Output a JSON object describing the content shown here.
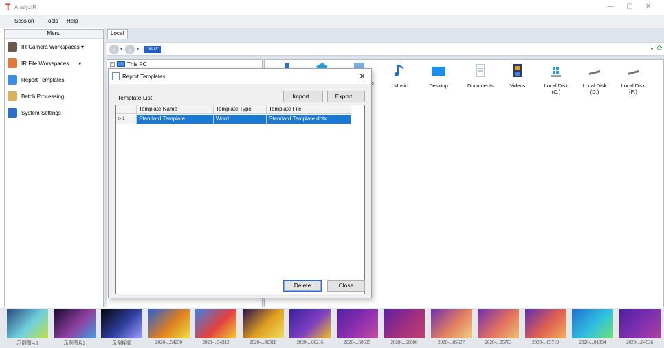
{
  "app": {
    "logo": "T",
    "title": "AnalyzIR"
  },
  "window_controls": {
    "minimize": "—",
    "maximize": "▢",
    "close": "✕"
  },
  "menubar": [
    "Session",
    "Tools",
    "Help"
  ],
  "left_panel": {
    "header": "Menu",
    "items": [
      {
        "label": "IR Camera Workspaces ▾",
        "icon": "camera-workspace-icon",
        "color": "#6b5a4a"
      },
      {
        "label": "IR File Workspaces",
        "icon": "file-workspace-icon",
        "color": "#e07a3a",
        "dropdown": "▾"
      },
      {
        "label": "Report Templates",
        "icon": "report-icon",
        "color": "#3f8be0"
      },
      {
        "label": "Batch Processing",
        "icon": "batch-icon",
        "color": "#d6b25a"
      },
      {
        "label": "System Settings",
        "icon": "settings-monitor-icon",
        "color": "#2c6fc9"
      }
    ]
  },
  "explorer": {
    "tab": "Local",
    "address": "This PC",
    "tree_root": "This PC",
    "items": [
      {
        "label": "Music",
        "icon": "music-icon"
      },
      {
        "label": "Desktop",
        "icon": "desktop-icon"
      },
      {
        "label": "Documents",
        "icon": "documents-icon"
      },
      {
        "label": "Videos",
        "icon": "videos-icon"
      },
      {
        "label": "Local Disk\n(C:)",
        "icon": "drive-c-icon"
      },
      {
        "label": "Local Disk\n(D:)",
        "icon": "drive-d-icon"
      },
      {
        "label": "Local Disk\n(F:)",
        "icon": "drive-f-icon"
      }
    ],
    "partial_label": "s"
  },
  "dialog": {
    "title": "Report Templates",
    "list_label": "Template List",
    "import_button": "Import...",
    "export_button": "Export...",
    "columns": [
      "Template Name",
      "Template Type",
      "Template File"
    ],
    "rows": [
      {
        "marker": "▷ 1",
        "name": "Standard Template",
        "type": "Word",
        "file": "Standard Template.dotx"
      }
    ],
    "delete_button": "Delete",
    "close_button": "Close"
  },
  "thumbnails": [
    {
      "label": "示例图片1",
      "colors": [
        "#2a4a7a",
        "#6fd0e0",
        "#c0e040"
      ]
    },
    {
      "label": "示例图片2",
      "colors": [
        "#1a0a30",
        "#9040a0",
        "#40a0e0"
      ]
    },
    {
      "label": "示例视频",
      "colors": [
        "#05050a",
        "#3040a0",
        "#a0a0ff"
      ]
    },
    {
      "label": "2020-...54250",
      "colors": [
        "#2a60d0",
        "#e08020",
        "#f0e040"
      ]
    },
    {
      "label": "2020-...54312",
      "colors": [
        "#4080e0",
        "#e04040",
        "#f0d030"
      ]
    },
    {
      "label": "2020-...81318",
      "colors": [
        "#2a1050",
        "#e0a020",
        "#f0e060"
      ]
    },
    {
      "label": "2020-...60216",
      "colors": [
        "#3a20a0",
        "#8040c0",
        "#f0c020"
      ]
    },
    {
      "label": "2020-...60505",
      "colors": [
        "#5020a0",
        "#9030b0",
        "#c050a0"
      ]
    },
    {
      "label": "2020-...60600",
      "colors": [
        "#6020a0",
        "#a03080",
        "#c04070"
      ]
    },
    {
      "label": "2020-...85627",
      "colors": [
        "#7030b0",
        "#e08060",
        "#f0d080"
      ]
    },
    {
      "label": "2020-...85703",
      "colors": [
        "#7030b0",
        "#e07060",
        "#f0c070"
      ]
    },
    {
      "label": "2020-...85719",
      "colors": [
        "#6030b0",
        "#e06050",
        "#f0b060"
      ]
    },
    {
      "label": "2020-...01834",
      "colors": [
        "#2070d0",
        "#30c0e0",
        "#70e070"
      ]
    },
    {
      "label": "2020-...04536",
      "colors": [
        "#5020a0",
        "#8030b0",
        "#b040a0"
      ]
    }
  ]
}
